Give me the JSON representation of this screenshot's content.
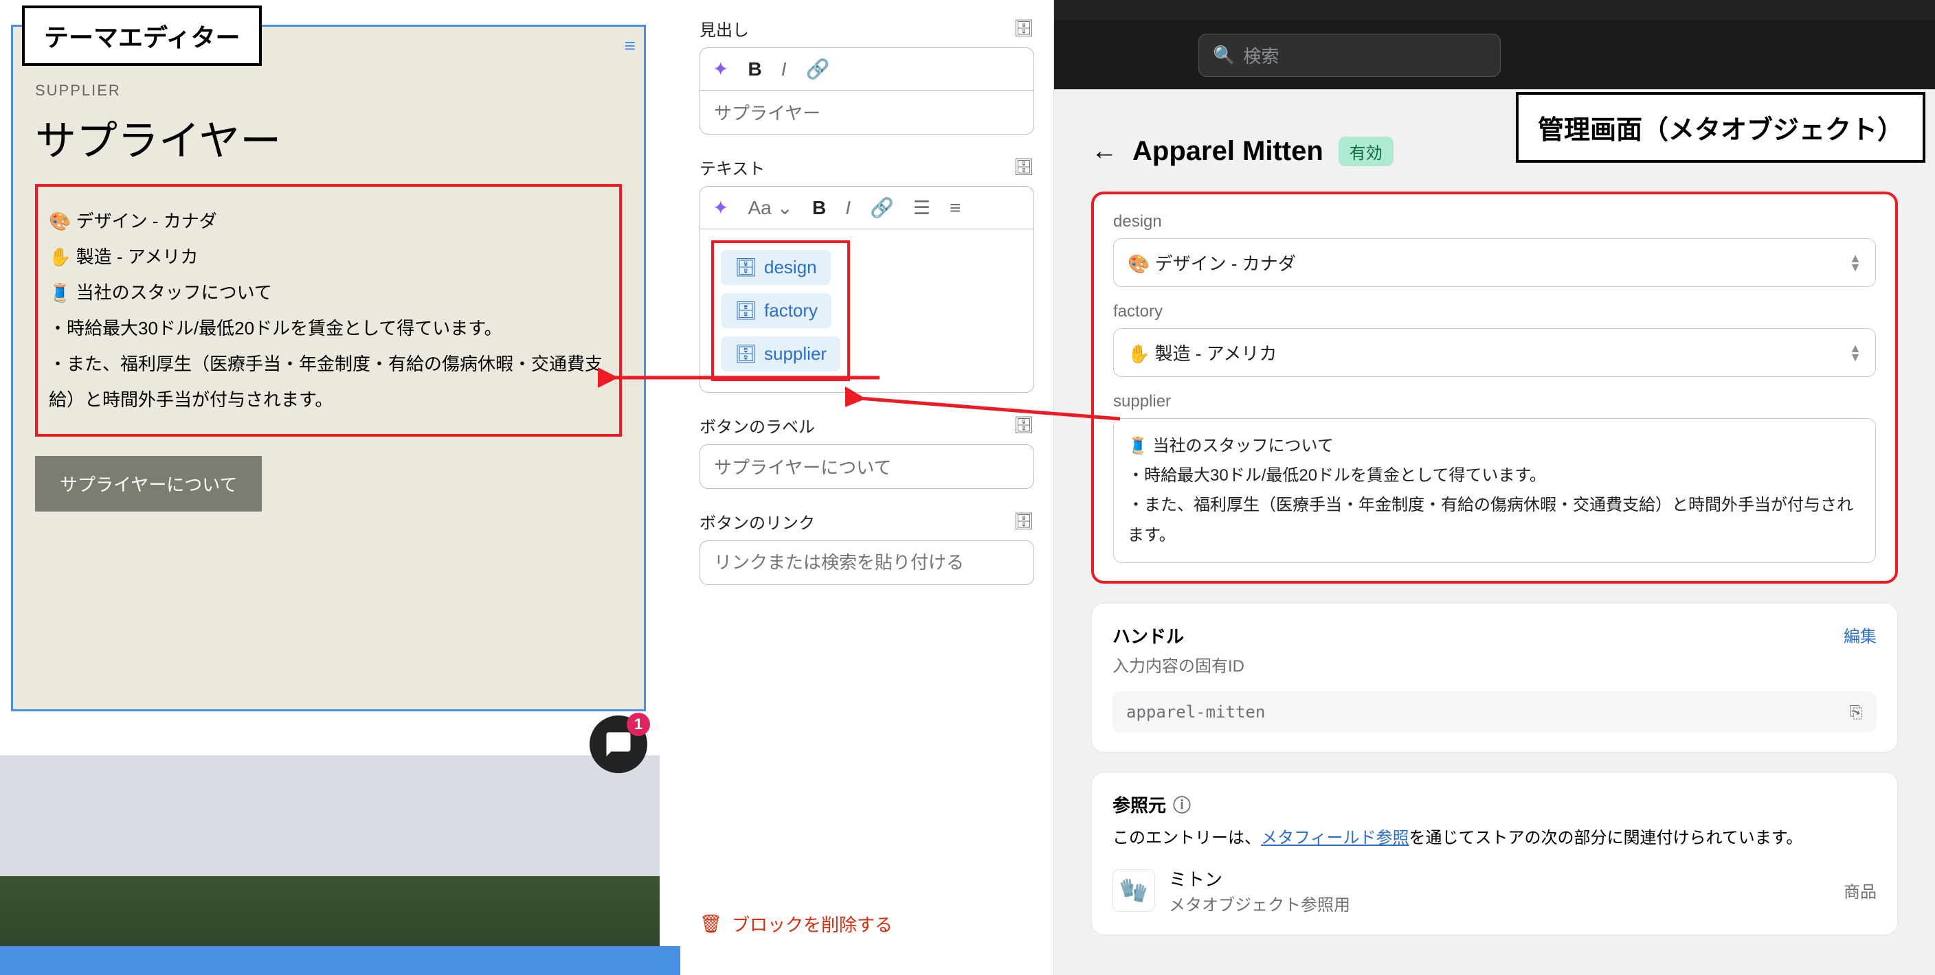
{
  "theme_editor": {
    "label": "テーマエディター",
    "supplier_tag": "SUPPLIER",
    "supplier_title": "サプライヤー",
    "lines": {
      "l1": "🎨 デザイン - カナダ",
      "l2": "✋ 製造 - アメリカ",
      "l3": "🧵 当社のスタッフについて",
      "l4": "・時給最大30ドル/最低20ドルを賃金として得ています。",
      "l5": "・また、福利厚生（医療手当・年金制度・有給の傷病休暇・交通費支給）と時間外手当が付与されます。"
    },
    "cta": "サプライヤーについて",
    "chat_badge": "1"
  },
  "settings": {
    "heading_label": "見出し",
    "heading_value": "サプライヤー",
    "text_label": "テキスト",
    "font_btn": "Aa",
    "tags": {
      "t1": "design",
      "t2": "factory",
      "t3": "supplier"
    },
    "btn_label_label": "ボタンのラベル",
    "btn_label_value": "サプライヤーについて",
    "btn_link_label": "ボタンのリンク",
    "btn_link_placeholder": "リンクまたは検索を貼り付ける",
    "delete": "ブロックを削除する"
  },
  "admin": {
    "search_placeholder": "検索",
    "label": "管理画面（メタオブジェクト）",
    "title": "Apparel Mitten",
    "status": "有効",
    "fields": {
      "design_label": "design",
      "design_value": "🎨 デザイン - カナダ",
      "factory_label": "factory",
      "factory_value": "✋ 製造 - アメリカ",
      "supplier_label": "supplier",
      "supplier_value": "🧵 当社のスタッフについて\n・時給最大30ドル/最低20ドルを賃金として得ています。\n・また、福利厚生（医療手当・年金制度・有給の傷病休暇・交通費支給）と時間外手当が付与されます。"
    },
    "handle": {
      "title": "ハンドル",
      "edit": "編集",
      "sub": "入力内容の固有ID",
      "value": "apparel-mitten"
    },
    "ref": {
      "title": "参照元",
      "desc1": "このエントリーは、",
      "link": "メタフィールド参照",
      "desc2": "を通じてストアの次の部分に関連付けられています。",
      "item_name": "ミトン",
      "item_sub": "メタオブジェクト参照用",
      "item_type": "商品",
      "thumb": "🧤"
    }
  }
}
